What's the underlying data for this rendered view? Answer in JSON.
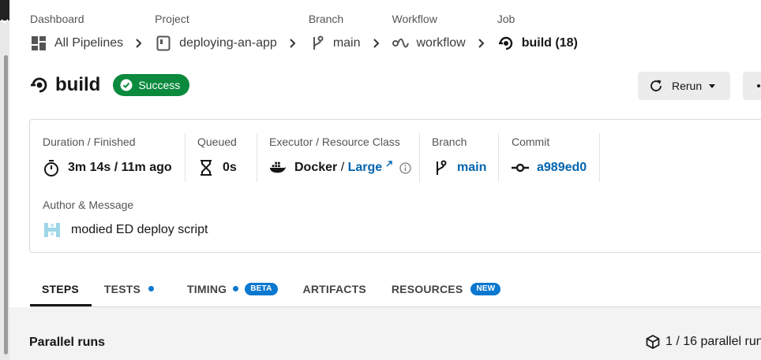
{
  "breadcrumb": [
    {
      "label": "Dashboard",
      "value": "All Pipelines",
      "icon": "dashboard-icon"
    },
    {
      "label": "Project",
      "value": "deploying-an-app",
      "icon": "project-icon"
    },
    {
      "label": "Branch",
      "value": "main",
      "icon": "branch-icon"
    },
    {
      "label": "Workflow",
      "value": "workflow",
      "icon": "workflow-icon"
    },
    {
      "label": "Job",
      "value": "build (18)",
      "icon": "job-icon"
    }
  ],
  "job": {
    "title": "build",
    "status": "Success",
    "status_color": "#0b8a3e"
  },
  "actions": {
    "rerun_label": "Rerun"
  },
  "details": {
    "duration": {
      "label": "Duration / Finished",
      "value": "3m 14s / 11m ago"
    },
    "queued": {
      "label": "Queued",
      "value": "0s"
    },
    "executor": {
      "label": "Executor / Resource Class",
      "executor": "Docker",
      "separator": " / ",
      "resource_class": "Large"
    },
    "branch": {
      "label": "Branch",
      "value": "main"
    },
    "commit": {
      "label": "Commit",
      "value": "a989ed0"
    },
    "author": {
      "label": "Author & Message",
      "message": "modied ED deploy script"
    }
  },
  "tabs": [
    {
      "label": "STEPS",
      "active": true
    },
    {
      "label": "TESTS",
      "dot": true
    },
    {
      "label": "TIMING",
      "dot": true,
      "pill": "BETA"
    },
    {
      "label": "ARTIFACTS"
    },
    {
      "label": "RESOURCES",
      "pill": "NEW"
    }
  ],
  "parallel": {
    "title": "Parallel runs",
    "count": "1 / 16 parallel run"
  },
  "colors": {
    "link": "#0064b0",
    "accent_blue": "#0b78d0",
    "success": "#0b8a3e"
  }
}
